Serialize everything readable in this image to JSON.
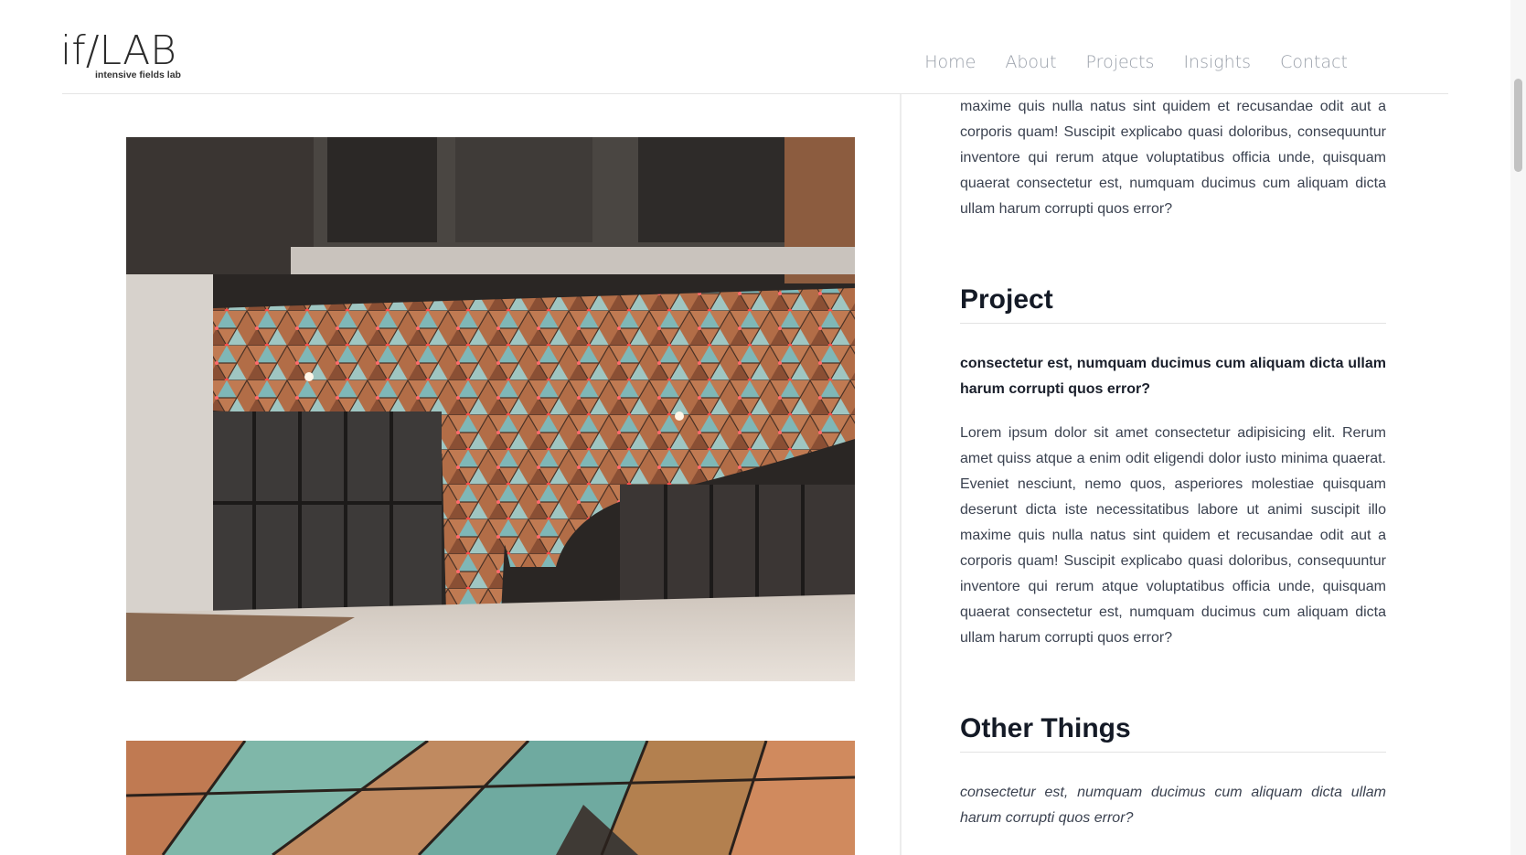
{
  "logo": {
    "mark": "if/LAB",
    "tagline": "intensive fields lab"
  },
  "nav": {
    "items": [
      "Home",
      "About",
      "Projects",
      "Insights",
      "Contact"
    ]
  },
  "content": {
    "intro_paragraph": "maxime quis nulla natus sint quidem et recusandae odit aut a corporis quam! Suscipit explicabo quasi doloribus, consequuntur inventore qui rerum atque voluptatibus officia unde, quisquam quaerat consectetur est, numquam ducimus cum aliquam dicta ullam harum corrupti quos error?",
    "project": {
      "heading": "Project",
      "lead": "consectetur est, numquam ducimus cum aliquam dicta ullam harum corrupti quos error?",
      "body": "Lorem ipsum dolor sit amet consectetur adipisicing elit. Rerum amet quiss atque a enim odit eligendi dolor iusto minima quaerat. Eveniet nesciunt, nemo quos, asperiores molestiae quisquam deserunt dicta iste necessitatibus labore ut animi suscipit illo maxime quis nulla natus sint quidem et recusandae odit aut a corporis quam! Suscipit explicabo quasi doloribus, consequuntur inventore qui rerum atque voluptatibus officia unde, quisquam quaerat consectetur est, numquam ducimus cum aliquam dicta ullam harum corrupti quos error?"
    },
    "other": {
      "heading": "Other Things",
      "lead": "consectetur est, numquam ducimus cum aliquam dicta ullam harum corrupti quos error?"
    }
  },
  "colors": {
    "nav": "#9aa0aa",
    "heading": "#141a26",
    "body": "#3b4250",
    "panel_teal": "#7fb7b7",
    "panel_copper": "#b86e45",
    "led": "#ff4a4a"
  }
}
